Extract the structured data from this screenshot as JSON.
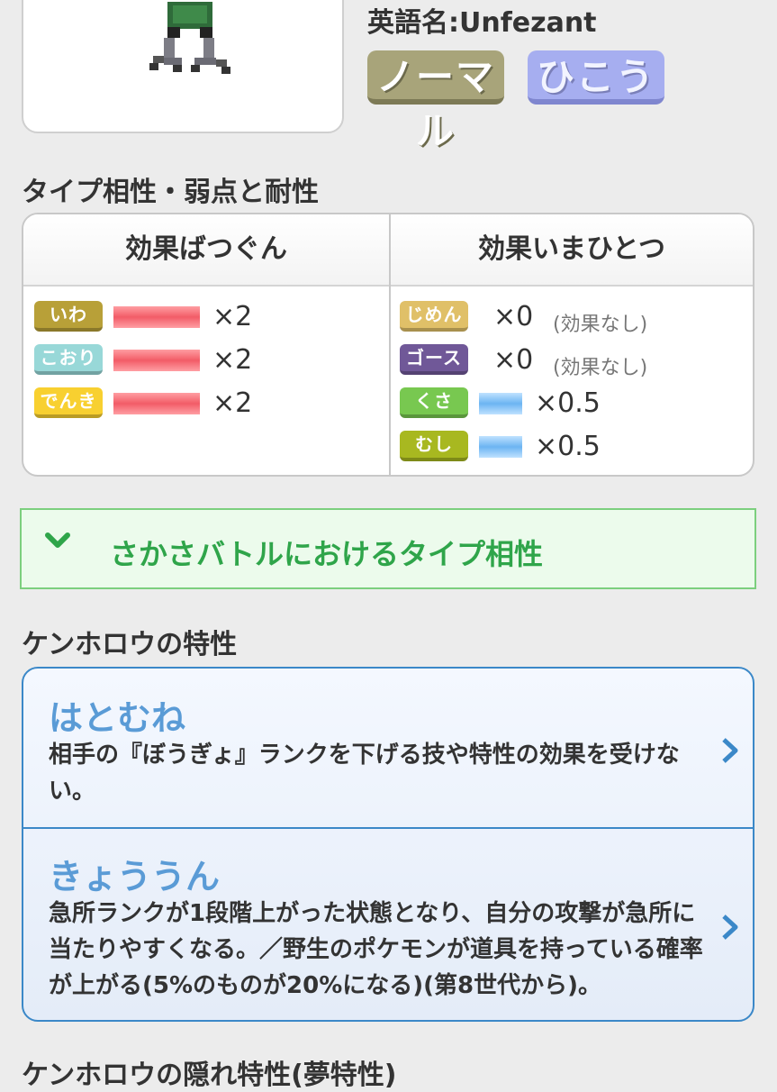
{
  "header": {
    "english_name": "英語名:Unfezant",
    "types": [
      {
        "label": "ノーマル"
      },
      {
        "label": "ひこう"
      }
    ]
  },
  "type_section": {
    "title": "タイプ相性・弱点と耐性",
    "weak": {
      "header": "効果ばつぐん",
      "rows": [
        {
          "type": "いわ",
          "color": "#b8a038",
          "mult": "×2"
        },
        {
          "type": "こおり",
          "color": "#98d8d8",
          "mult": "×2"
        },
        {
          "type": "でんき",
          "color": "#f8d030",
          "mult": "×2"
        }
      ]
    },
    "resist": {
      "header": "効果いまひとつ",
      "rows": [
        {
          "type": "じめん",
          "color": "#e0c068",
          "mult": "×0",
          "note": "(効果なし)"
        },
        {
          "type": "ゴースト",
          "color": "#705898",
          "mult": "×0",
          "note": "(効果なし)"
        },
        {
          "type": "くさ",
          "color": "#78c850",
          "mult": "×0.5"
        },
        {
          "type": "むし",
          "color": "#a8b820",
          "mult": "×0.5"
        }
      ]
    }
  },
  "reverse_battle": {
    "label": "さかさバトルにおけるタイプ相性"
  },
  "abilities_section": {
    "title": "ケンホロウの特性",
    "items": [
      {
        "name": "はとむね",
        "desc": "相手の『ぼうぎょ』ランクを下げる技や特性の効果を受けない。"
      },
      {
        "name": "きょううん",
        "desc": "急所ランクが1段階上がった状態となり、自分の攻撃が急所に当たりやすくなる。／野生のポケモンが道具を持っている確率が上がる(5%のものが20%になる)(第8世代から)。"
      }
    ]
  },
  "hidden_ability_title": "ケンホロウの隠れ特性(夢特性)",
  "colors": {
    "accent_green": "#2fa54a",
    "accent_blue": "#3b88c8",
    "weak_bar": "#f25c67",
    "resist_bar": "#6cb4f2"
  }
}
